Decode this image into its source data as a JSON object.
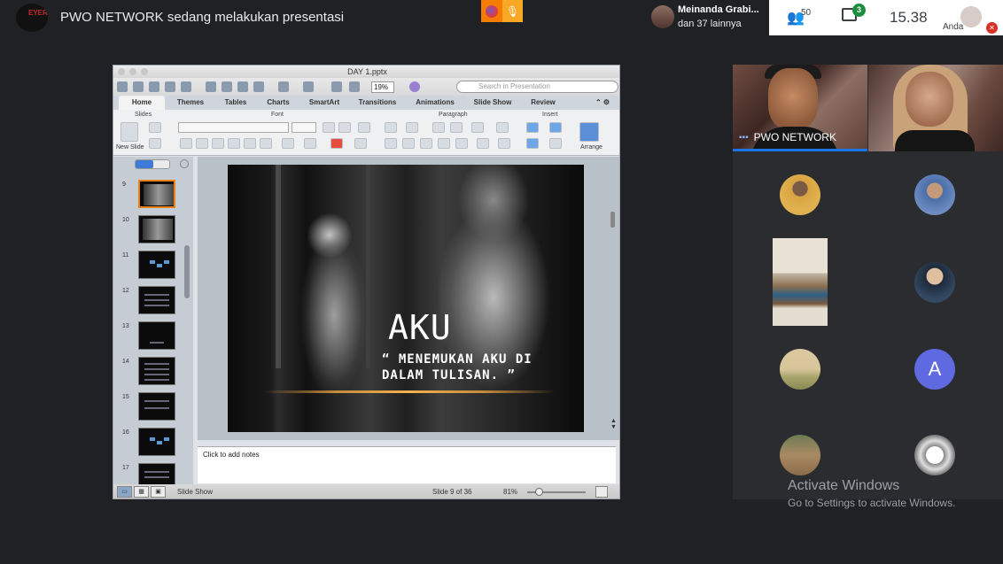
{
  "meet": {
    "presenter_banner": "PWO NETWORK sedang melakukan presentasi",
    "presenter_logo_text": "EYER",
    "participants_chip": {
      "name": "Meinanda Grabi...",
      "others": "dan 37 lainnya"
    },
    "participant_count": "50",
    "chat_badge": "3",
    "clock": "15.38",
    "me_label": "Anda",
    "tiles": {
      "main_left_name": "PWO NETWORK",
      "letter_avatar": "A"
    },
    "watermark": {
      "title": "Activate Windows",
      "subtitle": "Go to Settings to activate Windows."
    }
  },
  "powerpoint": {
    "window_title": "DAY 1.pptx",
    "zoom_toolbar": "19%",
    "search_placeholder": "Search in Presentation",
    "tabs": [
      "Home",
      "Themes",
      "Tables",
      "Charts",
      "SmartArt",
      "Transitions",
      "Animations",
      "Slide Show",
      "Review"
    ],
    "groups": [
      "Slides",
      "Font",
      "Paragraph",
      "Insert"
    ],
    "new_slide_label": "New Slide",
    "arrange_label": "Arrange",
    "thumbnails": [
      "9",
      "10",
      "11",
      "12",
      "13",
      "14",
      "15",
      "16",
      "17"
    ],
    "slide": {
      "title": "AKU",
      "subtitle": "“ MENEMUKAN AKU DI DALAM TULISAN. ”"
    },
    "notes_placeholder": "Click to add notes",
    "status": {
      "mode": "Slide Show",
      "slide_of": "Slide 9 of 36",
      "zoom": "81%"
    }
  }
}
